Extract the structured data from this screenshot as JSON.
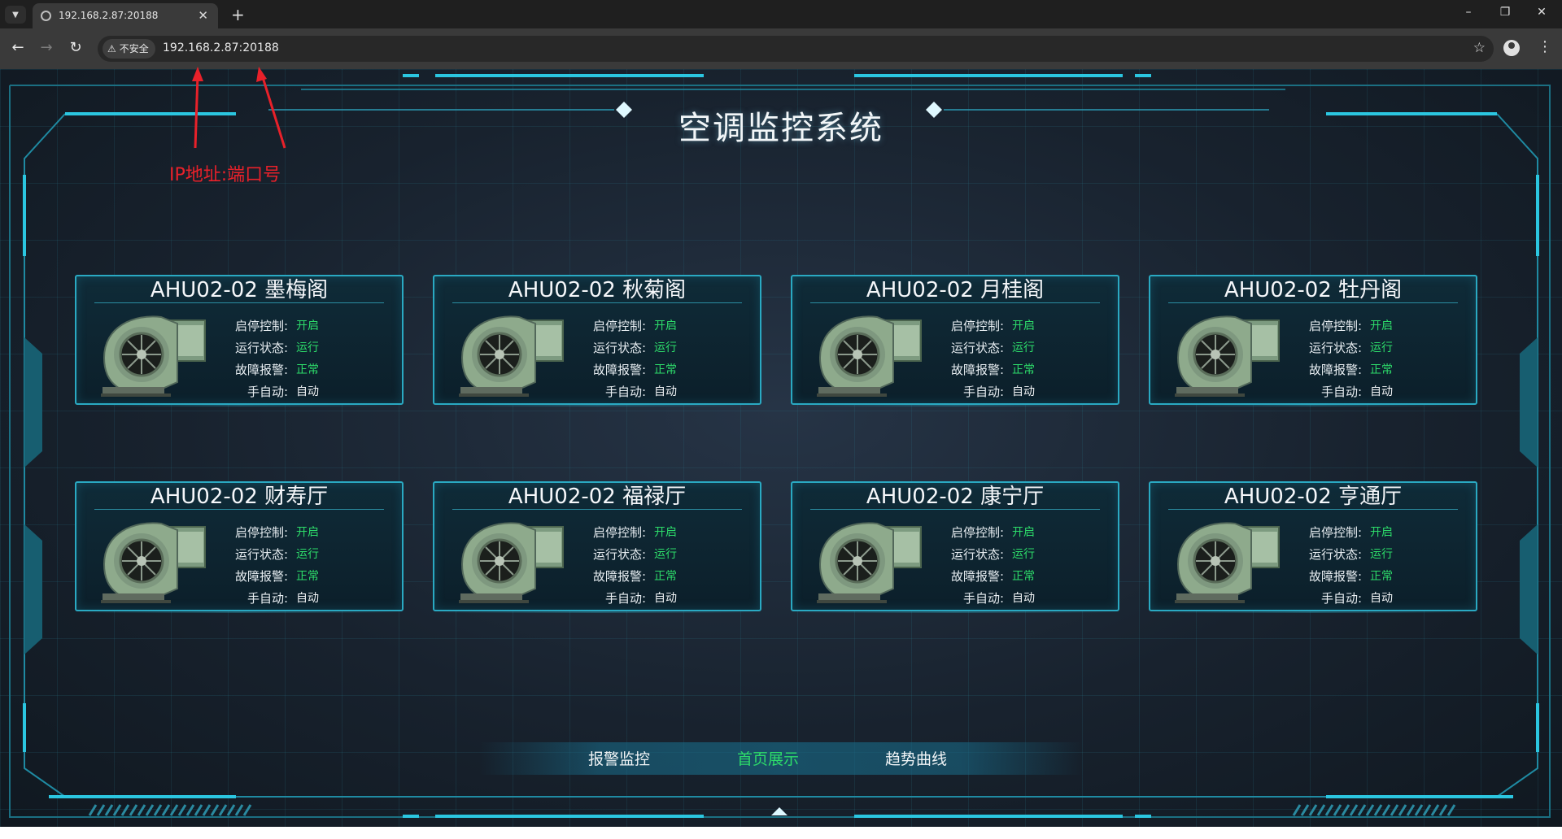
{
  "browser": {
    "tab_title": "192.168.2.87:20188",
    "security_label": "不安全",
    "url": "192.168.2.87:20188",
    "new_tab_icon": "plus-icon",
    "window_controls": [
      "minimize-icon",
      "restore-icon",
      "close-icon"
    ]
  },
  "annotation": {
    "text": "IP地址:端口号",
    "color": "#e8212a"
  },
  "dashboard": {
    "title": "空调监控系统",
    "accent": "#2aa9c2",
    "status_green": "#2ddc6a",
    "field_labels": {
      "control": "启停控制:",
      "run_state": "运行状态:",
      "fault": "故障报警:",
      "mode": "手自动:"
    },
    "units": [
      {
        "name": "AHU02-02 墨梅阁",
        "control": "开启",
        "run_state": "运行",
        "fault": "正常",
        "mode": "自动"
      },
      {
        "name": "AHU02-02 秋菊阁",
        "control": "开启",
        "run_state": "运行",
        "fault": "正常",
        "mode": "自动"
      },
      {
        "name": "AHU02-02 月桂阁",
        "control": "开启",
        "run_state": "运行",
        "fault": "正常",
        "mode": "自动"
      },
      {
        "name": "AHU02-02 牡丹阁",
        "control": "开启",
        "run_state": "运行",
        "fault": "正常",
        "mode": "自动"
      },
      {
        "name": "AHU02-02 财寿厅",
        "control": "开启",
        "run_state": "运行",
        "fault": "正常",
        "mode": "自动"
      },
      {
        "name": "AHU02-02 福禄厅",
        "control": "开启",
        "run_state": "运行",
        "fault": "正常",
        "mode": "自动"
      },
      {
        "name": "AHU02-02 康宁厅",
        "control": "开启",
        "run_state": "运行",
        "fault": "正常",
        "mode": "自动"
      },
      {
        "name": "AHU02-02 亨通厅",
        "control": "开启",
        "run_state": "运行",
        "fault": "正常",
        "mode": "自动"
      }
    ],
    "bottom_nav": [
      {
        "label": "报警监控",
        "active": false
      },
      {
        "label": "首页展示",
        "active": true
      },
      {
        "label": "趋势曲线",
        "active": false
      }
    ]
  }
}
